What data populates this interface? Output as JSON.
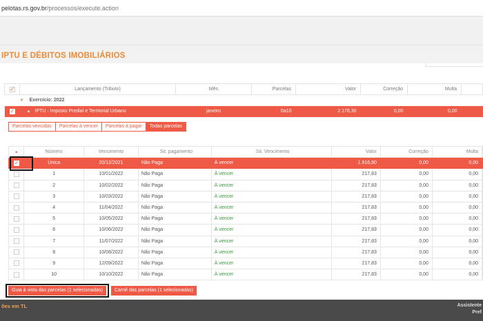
{
  "browser": {
    "url_host": "pelotas.rs.gov.br",
    "url_path": "/processos/execute.action"
  },
  "page": {
    "title": "IPTU E DÉBITOS IMOBILIÁRIOS"
  },
  "table1": {
    "headers": [
      "Lançamento (Tributo)",
      "Mês",
      "Parcelas",
      "Valor",
      "Correção",
      "Multa"
    ],
    "group_label": "Exercício: 2022",
    "row": {
      "tributo": "IPTU - Imposto Predial e Territorial Urbano",
      "mes": "janeiro",
      "parcelas": "0a10",
      "valor": "2.178,30",
      "correcao": "0,00",
      "multa": "0,00"
    }
  },
  "tabs": [
    "Parcelas vencidas",
    "Parcelas à vencer",
    "Parcelas à pagar",
    "Todas parcelas"
  ],
  "table2": {
    "headers": [
      "Número",
      "Vencimento",
      "Sit. pagamento",
      "Sit. Vencimento",
      "Valor",
      "Correção",
      "Multa"
    ],
    "rows": [
      {
        "numero": "Única",
        "vencimento": "20/12/2021",
        "sit_pag": "Não Paga",
        "sit_venc": "À vencer",
        "valor": "1.916,80",
        "correcao": "0,00",
        "multa": "0,00",
        "selected": true
      },
      {
        "numero": "1",
        "vencimento": "10/01/2022",
        "sit_pag": "Não Paga",
        "sit_venc": "À vencer",
        "valor": "217,83",
        "correcao": "0,00",
        "multa": "0,00"
      },
      {
        "numero": "2",
        "vencimento": "10/02/2022",
        "sit_pag": "Não Paga",
        "sit_venc": "À vencer",
        "valor": "217,83",
        "correcao": "0,00",
        "multa": "0,00"
      },
      {
        "numero": "3",
        "vencimento": "10/03/2022",
        "sit_pag": "Não Paga",
        "sit_venc": "À vencer",
        "valor": "217,83",
        "correcao": "0,00",
        "multa": "0,00"
      },
      {
        "numero": "4",
        "vencimento": "11/04/2022",
        "sit_pag": "Não Paga",
        "sit_venc": "À vencer",
        "valor": "217,83",
        "correcao": "0,00",
        "multa": "0,00"
      },
      {
        "numero": "5",
        "vencimento": "10/05/2022",
        "sit_pag": "Não Paga",
        "sit_venc": "À vencer",
        "valor": "217,83",
        "correcao": "0,00",
        "multa": "0,00"
      },
      {
        "numero": "6",
        "vencimento": "10/06/2022",
        "sit_pag": "Não Paga",
        "sit_venc": "À vencer",
        "valor": "217,83",
        "correcao": "0,00",
        "multa": "0,00"
      },
      {
        "numero": "7",
        "vencimento": "11/07/2022",
        "sit_pag": "Não Paga",
        "sit_venc": "À vencer",
        "valor": "217,83",
        "correcao": "0,00",
        "multa": "0,00"
      },
      {
        "numero": "8",
        "vencimento": "10/08/2022",
        "sit_pag": "Não Paga",
        "sit_venc": "À vencer",
        "valor": "217,83",
        "correcao": "0,00",
        "multa": "0,00"
      },
      {
        "numero": "9",
        "vencimento": "12/09/2022",
        "sit_pag": "Não Paga",
        "sit_venc": "À vencer",
        "valor": "217,83",
        "correcao": "0,00",
        "multa": "0,00"
      },
      {
        "numero": "10",
        "vencimento": "10/10/2022",
        "sit_pag": "Não Paga",
        "sit_venc": "À vencer",
        "valor": "217,83",
        "correcao": "0,00",
        "multa": "0,00"
      }
    ]
  },
  "actions": {
    "guia_label": "Guia à vista das parcelas (1 selecionadas)",
    "carne_label": "Carnê das parcelas (1 selecionadas)"
  },
  "footer": {
    "left": "ões em TL",
    "right_line1": "Assistente",
    "right_line2": "Pref"
  },
  "colors": {
    "accent": "#ee5a46",
    "title": "#ef8a35",
    "footer_bg": "#4a4a4a"
  }
}
